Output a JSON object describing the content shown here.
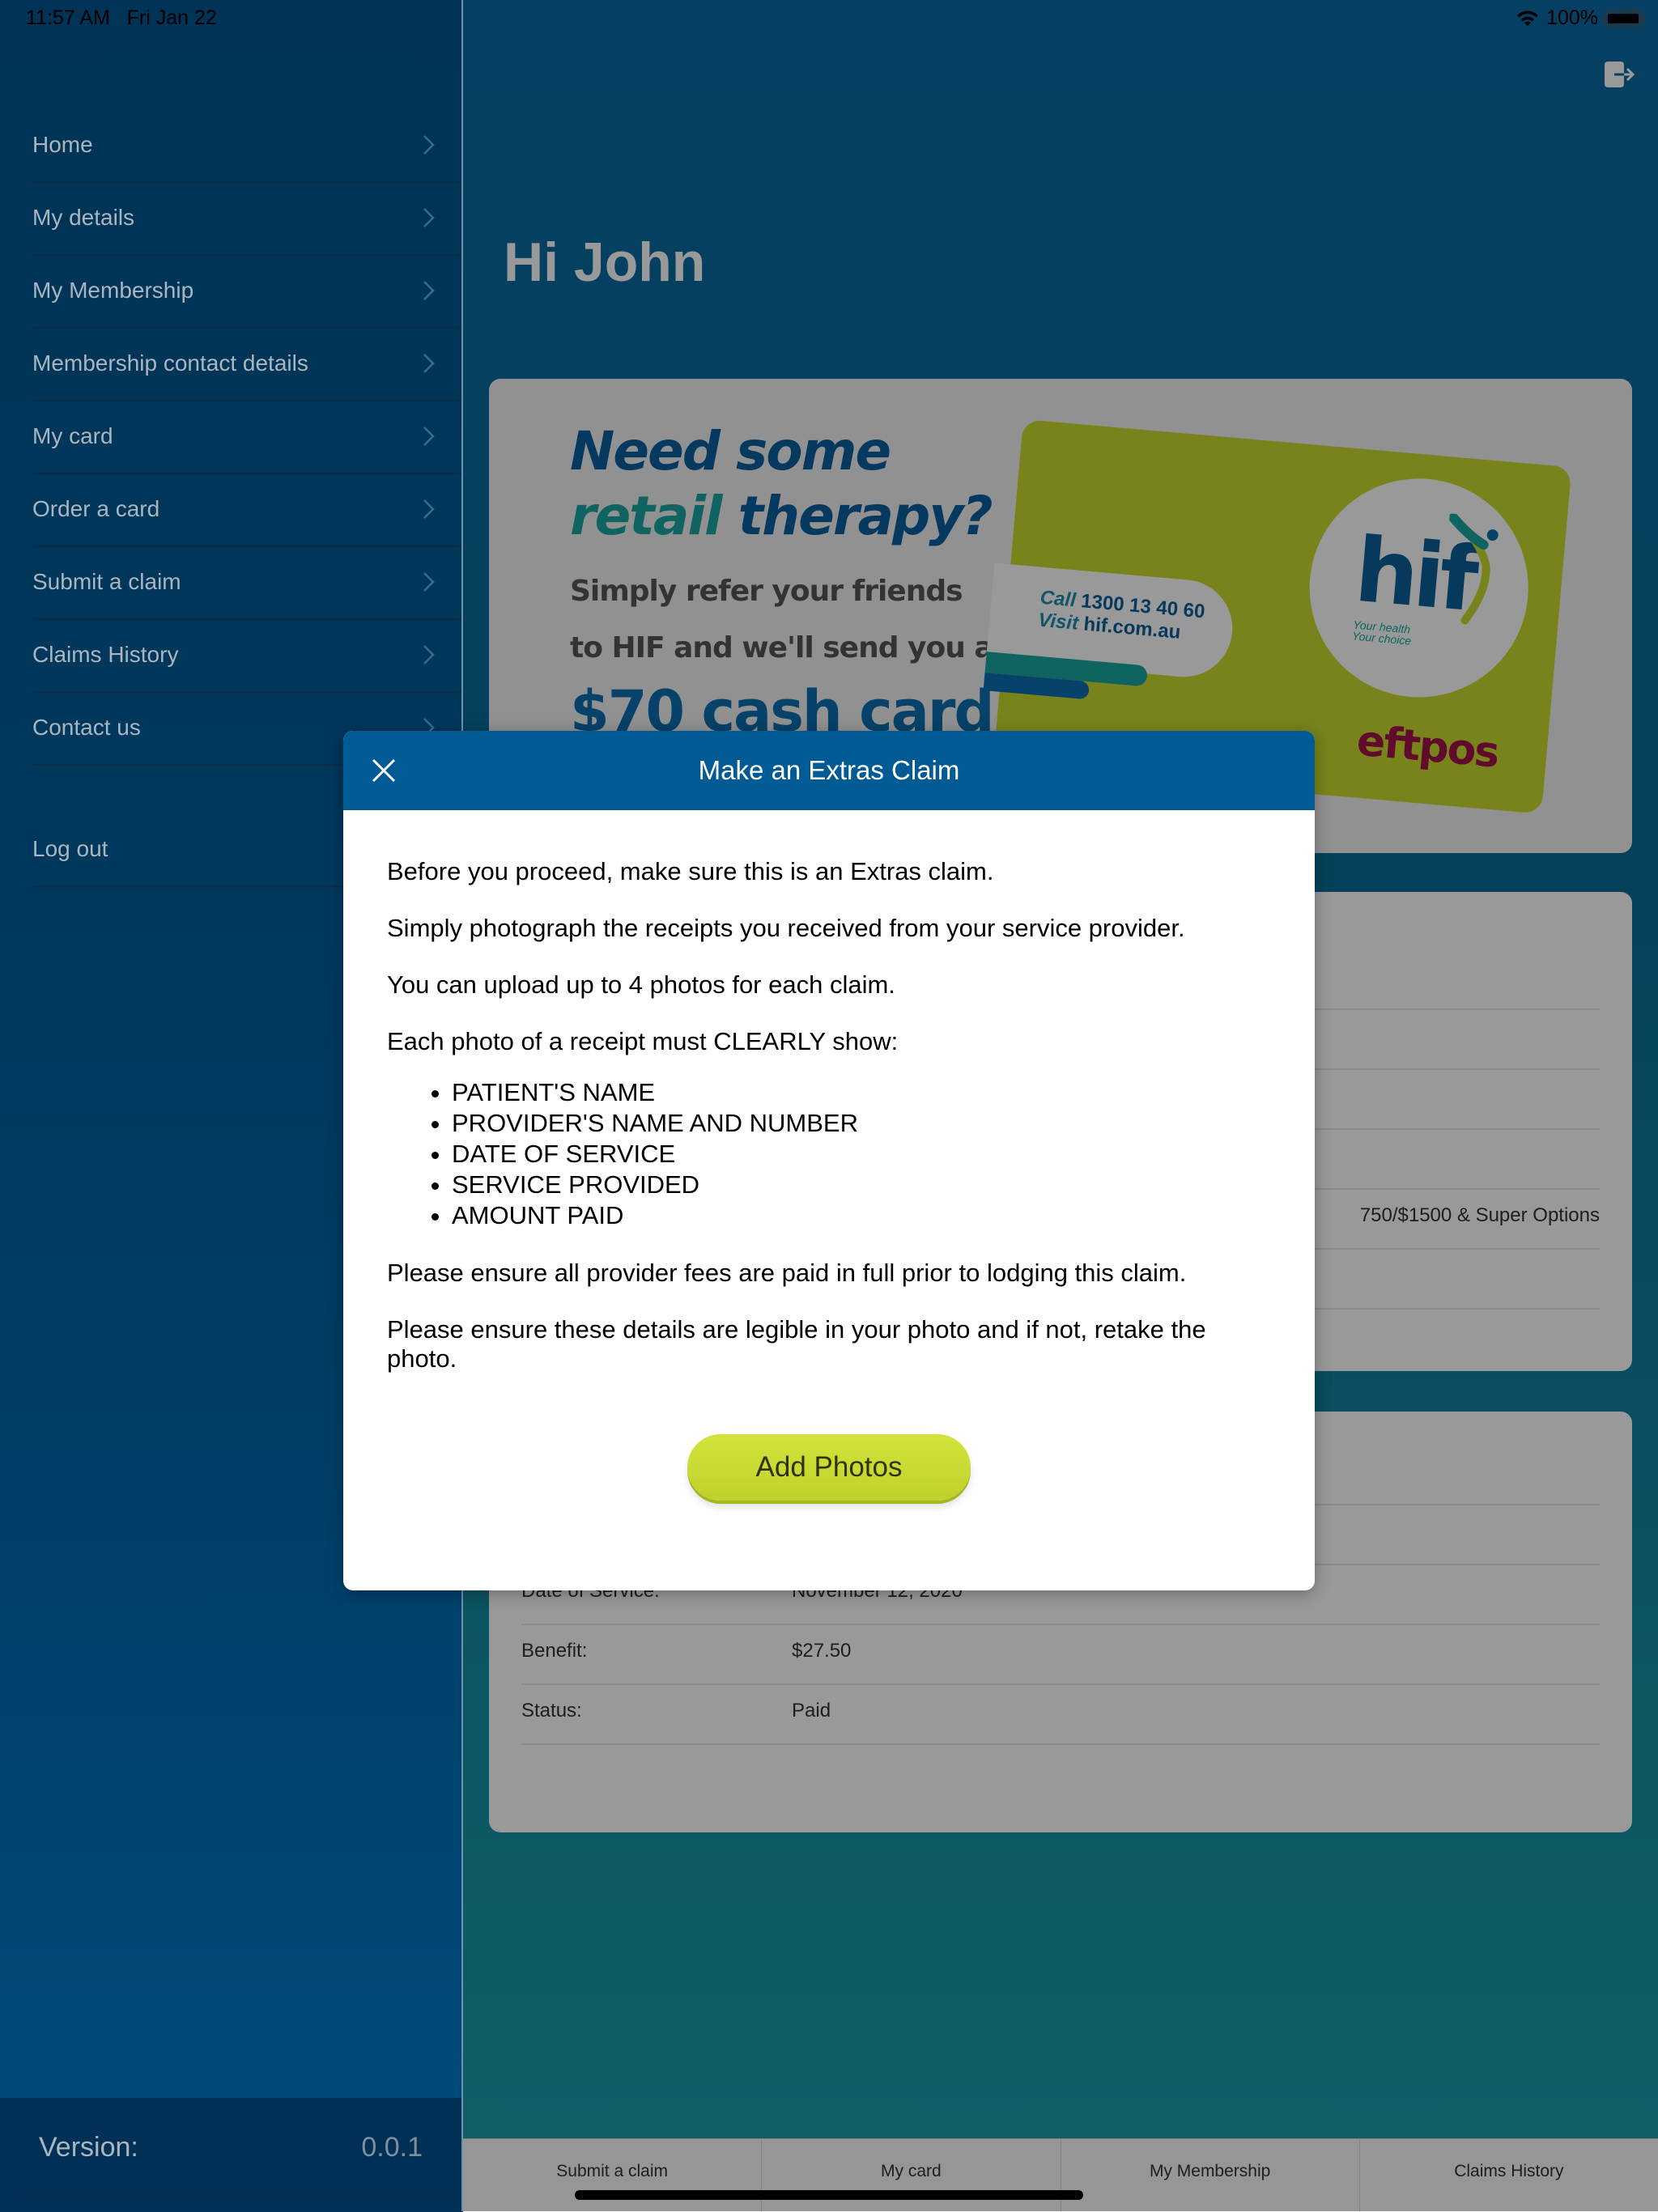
{
  "status_bar": {
    "time": "11:57 AM",
    "date": "Fri Jan 22",
    "battery": "100%",
    "wifi_icon": "wifi-icon",
    "battery_icon": "battery-icon"
  },
  "sidebar": {
    "items": [
      {
        "label": "Home"
      },
      {
        "label": "My details"
      },
      {
        "label": "My Membership"
      },
      {
        "label": "Membership contact details"
      },
      {
        "label": "My card"
      },
      {
        "label": "Order a card"
      },
      {
        "label": "Submit a claim"
      },
      {
        "label": "Claims History"
      },
      {
        "label": "Contact us"
      }
    ],
    "logout_label": "Log out",
    "version_label": "Version:",
    "version_value": "0.0.1"
  },
  "main": {
    "greeting": "Hi John",
    "logout_icon": "logout-icon",
    "promo": {
      "title_line1": "Need some",
      "title_line2_accent": "retail",
      "title_line2_rest": " therapy?",
      "sub_line1": "Simply refer your friends",
      "sub_line2": "to HIF and we'll send you a",
      "cash": "$70 cash card",
      "card_call_label": "Call",
      "card_call_number": "1300 13 40 60",
      "card_visit_label": "Visit",
      "card_visit_url": "hif.com.au",
      "card_brand": "hif",
      "card_tagline_1": "Your health",
      "card_tagline_2": "Your choice",
      "card_network": "eftpos"
    },
    "info_card": {
      "partial_value": "750/$1500 & Super Options"
    },
    "claim_card": {
      "rows": [
        {
          "label": "Date of Service:",
          "value": "November 12, 2020"
        },
        {
          "label": "Benefit:",
          "value": "$27.50"
        },
        {
          "label": "Status:",
          "value": "Paid"
        }
      ]
    },
    "bottom_tabs": [
      {
        "label": "Submit a claim"
      },
      {
        "label": "My card"
      },
      {
        "label": "My Membership"
      },
      {
        "label": "Claims History"
      }
    ]
  },
  "modal": {
    "title": "Make an Extras Claim",
    "paragraphs_top": [
      "Before you proceed, make sure this is an Extras claim.",
      "Simply photograph the receipts you received from your service provider.",
      "You can upload up to 4 photos for each claim.",
      "Each photo of a receipt must CLEARLY show:"
    ],
    "requirements": [
      "PATIENT'S NAME",
      "PROVIDER'S NAME AND NUMBER",
      "DATE OF SERVICE",
      "SERVICE PROVIDED",
      "AMOUNT PAID"
    ],
    "paragraphs_bottom": [
      "Please ensure all provider fees are paid in full prior to lodging this claim.",
      "Please ensure these details are legible in your photo and if not, retake the photo."
    ],
    "add_photos_label": "Add Photos"
  },
  "colors": {
    "sidebar_bg": "#003355",
    "modal_header": "#005b94",
    "accent_button": "#c8dd2e",
    "main_gradient_top": "#0a6aa3",
    "main_gradient_bottom": "#1a9fb0"
  }
}
